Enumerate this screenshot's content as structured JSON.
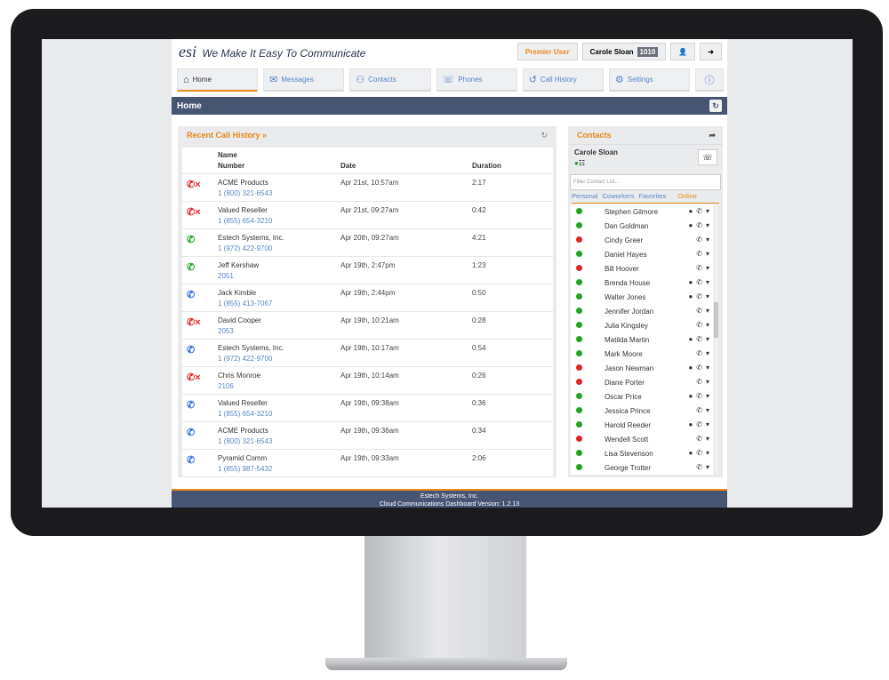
{
  "header": {
    "logo_mark": "esi",
    "tagline": "We Make It Easy To Communicate",
    "premier_label": "Premier User",
    "user_name": "Carole Sloan",
    "user_ext": "1010",
    "user_icon": "person-icon",
    "logout_icon": "logout-icon"
  },
  "nav": {
    "tabs": [
      {
        "label": "Home",
        "icon": "home-icon"
      },
      {
        "label": "Messages",
        "icon": "message-icon"
      },
      {
        "label": "Contacts",
        "icon": "contacts-icon"
      },
      {
        "label": "Phones",
        "icon": "phone-icon"
      },
      {
        "label": "Call History",
        "icon": "history-icon"
      },
      {
        "label": "Settings",
        "icon": "gear-icon"
      }
    ],
    "active": "Home",
    "help_icon": "help-icon"
  },
  "page": {
    "title": "Home"
  },
  "recent_calls": {
    "title": "Recent Call History »",
    "columns": {
      "name": "Name",
      "number": "Number",
      "date": "Date",
      "duration": "Duration"
    },
    "rows": [
      {
        "type": "missed",
        "name": "ACME Products",
        "number": "1 (800) 321-6543",
        "date": "Apr 21st, 10:57am",
        "duration": "2:17"
      },
      {
        "type": "missed",
        "name": "Valued Reseller",
        "number": "1 (855) 654-3210",
        "date": "Apr 21st, 09:27am",
        "duration": "0:42"
      },
      {
        "type": "incoming",
        "name": "Estech Systems, Inc.",
        "number": "1 (972) 422-9700",
        "date": "Apr 20th, 09:27am",
        "duration": "4:21"
      },
      {
        "type": "incoming",
        "name": "Jeff Kershaw",
        "number": "2051",
        "date": "Apr 19th, 2:47pm",
        "duration": "1:23"
      },
      {
        "type": "outgoing",
        "name": "Jack Kimble",
        "number": "1 (855) 413-7067",
        "date": "Apr 19th, 2:44pm",
        "duration": "0:50"
      },
      {
        "type": "missed",
        "name": "David Cooper",
        "number": "2053",
        "date": "Apr 19th, 10:21am",
        "duration": "0:28"
      },
      {
        "type": "outgoing",
        "name": "Estech Systems, Inc.",
        "number": "1 (972) 422-9700",
        "date": "Apr 19th, 10:17am",
        "duration": "0:54"
      },
      {
        "type": "missed",
        "name": "Chris Monroe",
        "number": "2106",
        "date": "Apr 19th, 10:14am",
        "duration": "0:26"
      },
      {
        "type": "outgoing",
        "name": "Valued Reseller",
        "number": "1 (855) 654-3210",
        "date": "Apr 19th, 09:38am",
        "duration": "0:36"
      },
      {
        "type": "outgoing",
        "name": "ACME Products",
        "number": "1 (800) 321-6543",
        "date": "Apr 19th, 09:36am",
        "duration": "0:34"
      },
      {
        "type": "outgoing",
        "name": "Pyramid Comm",
        "number": "1 (855) 987-5432",
        "date": "Apr 19th, 09:33am",
        "duration": "2:06"
      }
    ]
  },
  "contacts": {
    "title": "Contacts",
    "me": {
      "name": "Carole Sloan"
    },
    "filter_placeholder": "Filter Contact List...",
    "tabs": [
      "Personal",
      "Coworkers",
      "Favorites",
      "Online"
    ],
    "active_tab": "Online",
    "list": [
      {
        "name": "Stephen Gilmore",
        "status": "green",
        "chat": true
      },
      {
        "name": "Dan Goldman",
        "status": "green",
        "chat": true
      },
      {
        "name": "Cindy Greer",
        "status": "red",
        "chat": false
      },
      {
        "name": "Daniel Hayes",
        "status": "green",
        "chat": false
      },
      {
        "name": "Bill Hoover",
        "status": "red",
        "chat": false
      },
      {
        "name": "Brenda House",
        "status": "green",
        "chat": true
      },
      {
        "name": "Walter Jones",
        "status": "green",
        "chat": true
      },
      {
        "name": "Jennifer Jordan",
        "status": "green",
        "chat": false
      },
      {
        "name": "Julia Kingsley",
        "status": "green",
        "chat": false
      },
      {
        "name": "Matilda Martin",
        "status": "green",
        "chat": true
      },
      {
        "name": "Mark Moore",
        "status": "green",
        "chat": false
      },
      {
        "name": "Jason Newman",
        "status": "red",
        "chat": true
      },
      {
        "name": "Diane Porter",
        "status": "red",
        "chat": false
      },
      {
        "name": "Oscar Price",
        "status": "green",
        "chat": true
      },
      {
        "name": "Jessica Prince",
        "status": "green",
        "chat": false
      },
      {
        "name": "Harold Reeder",
        "status": "green",
        "chat": true
      },
      {
        "name": "Wendell Scott",
        "status": "red",
        "chat": false
      },
      {
        "name": "Lisa Stevenson",
        "status": "green",
        "chat": true
      },
      {
        "name": "George Trotter",
        "status": "green",
        "chat": false
      }
    ]
  },
  "footer": {
    "line1": "Estech Systems, Inc.",
    "line2": "Cloud Communications Dashboard Version: 1.2.13"
  },
  "colors": {
    "accent": "#e8891a",
    "titlebar": "#485572",
    "link": "#5a86c4",
    "missed": "#e02424",
    "incoming": "#21a321",
    "outgoing": "#2e6fd8",
    "online": "#22a322",
    "busy": "#e02424"
  }
}
